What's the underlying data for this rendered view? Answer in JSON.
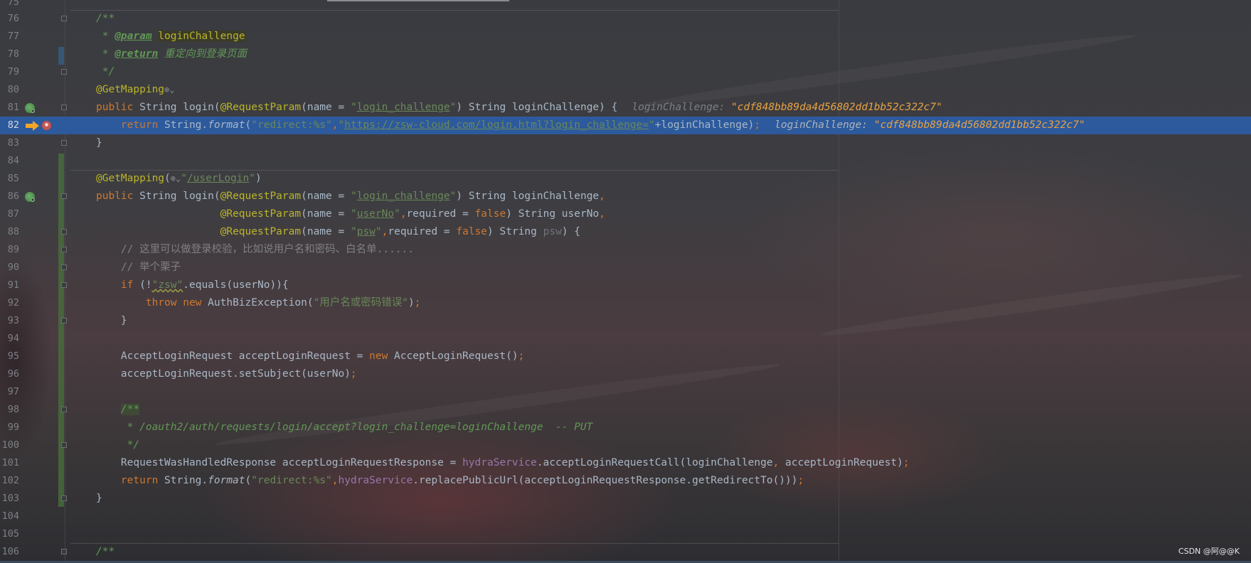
{
  "editor": {
    "lines": [
      {
        "num": "76",
        "segments": [
          {
            "c": "dc",
            "t": "/**"
          }
        ]
      },
      {
        "num": "77",
        "segments": [
          {
            "c": "dc",
            "t": " * "
          },
          {
            "c": "dt",
            "t": "@param"
          },
          {
            "c": "dc",
            "t": " "
          },
          {
            "c": "hl-param",
            "t": "loginChallenge"
          }
        ]
      },
      {
        "num": "78",
        "segments": [
          {
            "c": "dc",
            "t": " * "
          },
          {
            "c": "dt",
            "t": "@return"
          },
          {
            "c": "dc",
            "t": " 重定向到登录页面"
          }
        ]
      },
      {
        "num": "79",
        "segments": [
          {
            "c": "dc",
            "t": " */"
          }
        ]
      },
      {
        "num": "80",
        "segments": [
          {
            "c": "an",
            "t": "@GetMapping"
          },
          {
            "c": "globe",
            "t": "⊕⌄"
          }
        ]
      },
      {
        "num": "81",
        "segments": [
          {
            "c": "k",
            "t": "public "
          },
          {
            "c": "",
            "t": "String "
          },
          {
            "c": "",
            "t": "login("
          },
          {
            "c": "an",
            "t": "@RequestParam"
          },
          {
            "c": "",
            "t": "(name = "
          },
          {
            "c": "s",
            "t": "\""
          },
          {
            "c": "u",
            "t": "login_challenge"
          },
          {
            "c": "s",
            "t": "\""
          },
          {
            "c": "",
            "t": ") String loginChallenge) {"
          }
        ],
        "hint": {
          "label": "loginChallenge: ",
          "value": "\"cdf848bb89da4d56802dd1bb52c322c7\""
        }
      },
      {
        "num": "82",
        "current": true,
        "segments": [
          {
            "c": "",
            "t": "    "
          },
          {
            "c": "k",
            "t": "return "
          },
          {
            "c": "",
            "t": "String."
          },
          {
            "c": "it",
            "t": "format"
          },
          {
            "c": "",
            "t": "("
          },
          {
            "c": "s",
            "t": "\"redirect:%s\""
          },
          {
            "c": "k",
            "t": ","
          },
          {
            "c": "s",
            "t": "\""
          },
          {
            "c": "u",
            "t": "https://zsw-cloud.com/login.html?login_challenge="
          },
          {
            "c": "s",
            "t": "\""
          },
          {
            "c": "",
            "t": "+loginChallenge)"
          },
          {
            "c": "k",
            "t": ";"
          }
        ],
        "hint": {
          "label": "loginChallenge: ",
          "value": "\"cdf848bb89da4d56802dd1bb52c322c7\""
        }
      },
      {
        "num": "83",
        "segments": [
          {
            "c": "",
            "t": "}"
          }
        ]
      },
      {
        "num": "84",
        "segments": []
      },
      {
        "num": "85",
        "segments": [
          {
            "c": "an",
            "t": "@GetMapping"
          },
          {
            "c": "",
            "t": "("
          },
          {
            "c": "globe",
            "t": "⊕⌄"
          },
          {
            "c": "s",
            "t": "\""
          },
          {
            "c": "u",
            "t": "/userLogin"
          },
          {
            "c": "s",
            "t": "\""
          },
          {
            "c": "",
            "t": ")"
          }
        ]
      },
      {
        "num": "86",
        "segments": [
          {
            "c": "k",
            "t": "public "
          },
          {
            "c": "",
            "t": "String "
          },
          {
            "c": "",
            "t": "login("
          },
          {
            "c": "an",
            "t": "@RequestParam"
          },
          {
            "c": "",
            "t": "(name = "
          },
          {
            "c": "s",
            "t": "\""
          },
          {
            "c": "u",
            "t": "login_challenge"
          },
          {
            "c": "s",
            "t": "\""
          },
          {
            "c": "",
            "t": ") String loginChallenge"
          },
          {
            "c": "k",
            "t": ","
          }
        ]
      },
      {
        "num": "87",
        "segments": [
          {
            "c": "",
            "t": "                    "
          },
          {
            "c": "an",
            "t": "@RequestParam"
          },
          {
            "c": "",
            "t": "(name = "
          },
          {
            "c": "s",
            "t": "\""
          },
          {
            "c": "u",
            "t": "userNo"
          },
          {
            "c": "s",
            "t": "\""
          },
          {
            "c": "k",
            "t": ","
          },
          {
            "c": "",
            "t": "required = "
          },
          {
            "c": "k",
            "t": "false"
          },
          {
            "c": "",
            "t": ") String userNo"
          },
          {
            "c": "k",
            "t": ","
          }
        ]
      },
      {
        "num": "88",
        "segments": [
          {
            "c": "",
            "t": "                    "
          },
          {
            "c": "an",
            "t": "@RequestParam"
          },
          {
            "c": "",
            "t": "(name = "
          },
          {
            "c": "s",
            "t": "\""
          },
          {
            "c": "u",
            "t": "psw"
          },
          {
            "c": "s",
            "t": "\""
          },
          {
            "c": "k",
            "t": ","
          },
          {
            "c": "",
            "t": "required = "
          },
          {
            "c": "k",
            "t": "false"
          },
          {
            "c": "",
            "t": ") String "
          },
          {
            "c": "dim",
            "t": "psw"
          },
          {
            "c": "",
            "t": ") {"
          }
        ]
      },
      {
        "num": "89",
        "segments": [
          {
            "c": "",
            "t": "    "
          },
          {
            "c": "cm",
            "t": "// 这里可以做登录校验，比如说用户名和密码、白名单......"
          }
        ]
      },
      {
        "num": "90",
        "segments": [
          {
            "c": "",
            "t": "    "
          },
          {
            "c": "cm",
            "t": "// 举个栗子"
          }
        ]
      },
      {
        "num": "91",
        "segments": [
          {
            "c": "",
            "t": "    "
          },
          {
            "c": "k",
            "t": "if "
          },
          {
            "c": "",
            "t": "(!"
          },
          {
            "c": "s squig",
            "t": "\"zsw\""
          },
          {
            "c": "",
            "t": ".equals(userNo)){"
          }
        ]
      },
      {
        "num": "92",
        "segments": [
          {
            "c": "",
            "t": "        "
          },
          {
            "c": "k",
            "t": "throw new "
          },
          {
            "c": "",
            "t": "AuthBizException("
          },
          {
            "c": "s",
            "t": "\"用户名或密码错误\""
          },
          {
            "c": "",
            "t": ")"
          },
          {
            "c": "k",
            "t": ";"
          }
        ]
      },
      {
        "num": "93",
        "segments": [
          {
            "c": "",
            "t": "    }"
          }
        ]
      },
      {
        "num": "94",
        "segments": []
      },
      {
        "num": "95",
        "segments": [
          {
            "c": "",
            "t": "    AcceptLoginRequest acceptLoginRequest = "
          },
          {
            "c": "k",
            "t": "new "
          },
          {
            "c": "",
            "t": "AcceptLoginRequest()"
          },
          {
            "c": "k",
            "t": ";"
          }
        ]
      },
      {
        "num": "96",
        "segments": [
          {
            "c": "",
            "t": "    acceptLoginRequest.setSubject(userNo)"
          },
          {
            "c": "k",
            "t": ";"
          }
        ]
      },
      {
        "num": "97",
        "segments": []
      },
      {
        "num": "98",
        "segments": [
          {
            "c": "",
            "t": "    "
          },
          {
            "c": "dc doc-box",
            "t": "/**"
          }
        ]
      },
      {
        "num": "99",
        "segments": [
          {
            "c": "",
            "t": "    "
          },
          {
            "c": "dc",
            "t": " * /oauth2/auth/requests/login/accept?login_challenge=loginChallenge  -- PUT"
          }
        ]
      },
      {
        "num": "100",
        "segments": [
          {
            "c": "",
            "t": "    "
          },
          {
            "c": "dc",
            "t": " */"
          }
        ]
      },
      {
        "num": "101",
        "segments": [
          {
            "c": "",
            "t": "    RequestWasHandledResponse acceptLoginRequestResponse = "
          },
          {
            "c": "fld",
            "t": "hydraService"
          },
          {
            "c": "",
            "t": ".acceptLoginRequestCall(loginChallenge"
          },
          {
            "c": "k",
            "t": ", "
          },
          {
            "c": "",
            "t": "acceptLoginRequest)"
          },
          {
            "c": "k",
            "t": ";"
          }
        ]
      },
      {
        "num": "102",
        "segments": [
          {
            "c": "",
            "t": "    "
          },
          {
            "c": "k",
            "t": "return "
          },
          {
            "c": "",
            "t": "String."
          },
          {
            "c": "it",
            "t": "format"
          },
          {
            "c": "",
            "t": "("
          },
          {
            "c": "s",
            "t": "\"redirect:%s\""
          },
          {
            "c": "k",
            "t": ","
          },
          {
            "c": "fld",
            "t": "hydraService"
          },
          {
            "c": "",
            "t": ".replacePublicUrl(acceptLoginRequestResponse.getRedirectTo()))"
          },
          {
            "c": "k",
            "t": ";"
          }
        ]
      },
      {
        "num": "103",
        "segments": [
          {
            "c": "",
            "t": "}"
          }
        ]
      },
      {
        "num": "104",
        "segments": []
      },
      {
        "num": "105",
        "segments": []
      },
      {
        "num": "106",
        "segments": [
          {
            "c": "dc",
            "t": "/**"
          }
        ]
      }
    ],
    "first_line_partial": "75"
  },
  "watermark": "CSDN @阿@@K",
  "colors": {
    "current_line": "#2d5a9c",
    "keyword": "#cc7832",
    "string": "#6a8759",
    "annotation": "#bbb529",
    "doc_comment": "#629755",
    "inline_value": "#e8a243"
  },
  "icons": {
    "bean_method": "spring-bean-icon",
    "execution_point": "execution-point-arrow-icon",
    "breakpoint": "breakpoint-icon"
  }
}
